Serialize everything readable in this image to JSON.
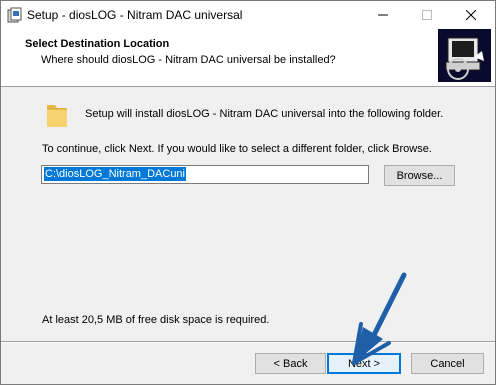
{
  "window": {
    "title": "Setup - diosLOG - Nitram DAC universal",
    "controls": {
      "minimize": "—",
      "maximize": "☐",
      "close": "✕"
    }
  },
  "header": {
    "title": "Select Destination Location",
    "subtitle": "Where should diosLOG - Nitram DAC universal be installed?"
  },
  "body": {
    "install_text": "Setup will install diosLOG - Nitram DAC universal into the following folder.",
    "continue_text": "To continue, click Next. If you would like to select a different folder, click Browse.",
    "path_value": "C:\\diosLOG_Nitram_DACuni",
    "browse_label": "Browse...",
    "space_text": "At least 20,5 MB of free disk space is required."
  },
  "footer": {
    "back_label": "< Back",
    "next_label": "Next >",
    "cancel_label": "Cancel"
  },
  "icons": {
    "app": "setup-app-icon",
    "folder": "folder-icon",
    "header_image": "computer-disk-icon",
    "annotation": "blue-arrow-pointing-next"
  },
  "colors": {
    "accent": "#0078d7",
    "arrow": "#1f5fa8",
    "header_bg": "#ffffff",
    "window_bg": "#f0f0f0"
  }
}
